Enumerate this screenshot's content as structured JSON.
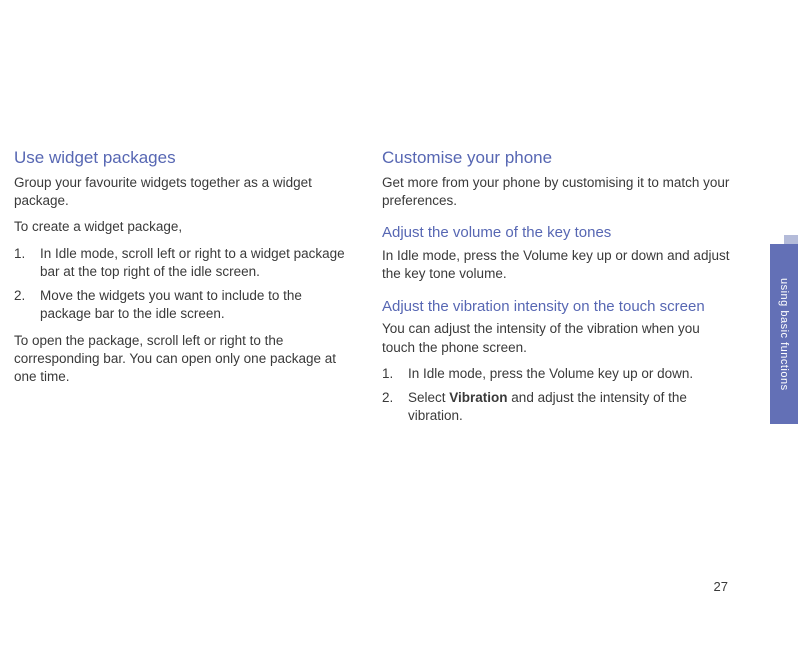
{
  "sidebar": {
    "label": "using basic functions"
  },
  "left": {
    "heading": "Use widget packages",
    "intro": "Group your favourite widgets together as a widget package.",
    "to_create": "To create a widget package,",
    "steps": [
      "In Idle mode, scroll left or right to a widget package bar at the top right of the idle screen.",
      "Move the widgets you want to include to the package bar to the idle screen."
    ],
    "to_open": "To open the package, scroll left or right to the corresponding bar. You can open only one package at one time."
  },
  "right": {
    "heading": "Customise your phone",
    "intro": "Get more from your phone by customising it to match your preferences.",
    "section1": {
      "heading": "Adjust the volume of the key tones",
      "body": "In Idle mode, press the Volume key up or down and adjust the key tone volume."
    },
    "section2": {
      "heading": "Adjust the vibration intensity on the touch screen",
      "body": "You can adjust the intensity of the vibration when you touch the phone screen.",
      "steps": [
        "In Idle mode, press the Volume key up or down."
      ],
      "step2_prefix": "Select ",
      "step2_bold": "Vibration",
      "step2_suffix": " and adjust the intensity of the vibration."
    }
  },
  "page_number": "27"
}
